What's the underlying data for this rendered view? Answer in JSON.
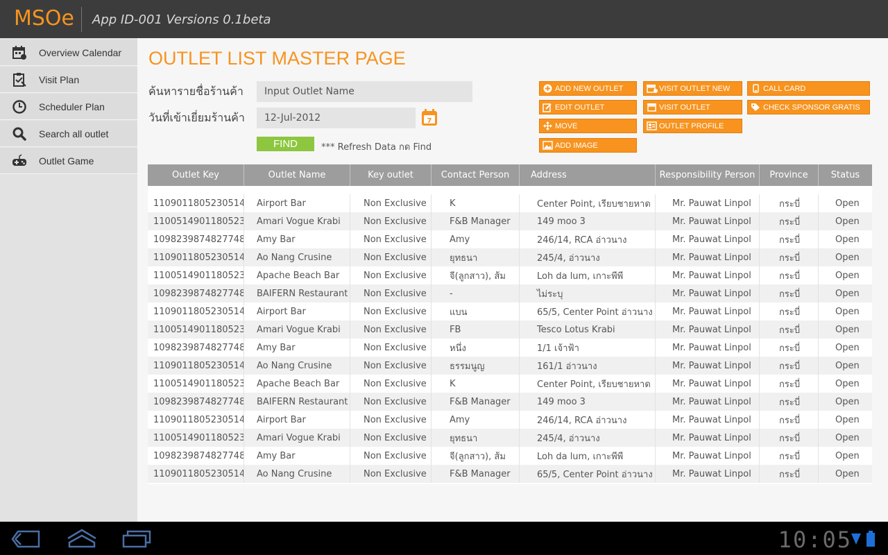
{
  "app": {
    "brand": "MSOe",
    "title": "App ID-001 Versions 0.1beta"
  },
  "sidebar": {
    "items": [
      {
        "label": "Overview Calendar",
        "icon": "calendar-icon"
      },
      {
        "label": "Visit Plan",
        "icon": "clipboard-icon"
      },
      {
        "label": "Scheduler Plan",
        "icon": "clock-icon"
      },
      {
        "label": "Search all outlet",
        "icon": "search-icon"
      },
      {
        "label": "Outlet Game",
        "icon": "gamepad-icon"
      }
    ]
  },
  "main": {
    "page_title": "OUTLET LIST MASTER PAGE",
    "search_label": "ค้นหารายชื่อร้านค้า",
    "search_placeholder": "Input Outlet Name",
    "date_label": "วันที่เข้าเยี่ยมร้านค้า",
    "date_value": "12-Jul-2012",
    "date_icon": "calendar-icon",
    "find_label": "FIND",
    "refresh_note": "*** Refresh Data กด Find"
  },
  "actions": {
    "add_new_outlet": "ADD NEW OUTLET",
    "edit_outlet": "EDIT OUTLET",
    "move": "MOVE",
    "add_image": "ADD IMAGE",
    "visit_outlet_new": "VISIT OUTLET NEW",
    "visit_outlet": "VISIT OUTLET",
    "outlet_profile": "OUTLET PROFILE",
    "call_card": "CALL CARD",
    "check_sponsor_gratis": "CHECK SPONSOR GRATIS"
  },
  "table": {
    "headers": [
      "Outlet Key",
      "Outlet Name",
      "Key outlet",
      "Contact Person",
      "Address",
      "Responsibility Person",
      "Province",
      "Status"
    ],
    "rows": [
      [
        "1109011805230514",
        "Airport Bar",
        "Non Exclusive",
        "K",
        "Center Point, เรียบชายหาด",
        "Mr. Pauwat Linpol",
        "กระบี่",
        "Open"
      ],
      [
        "1100514901180523",
        "Amari Vogue Krabi",
        "Non Exclusive",
        "F&B Manager",
        "149 moo 3",
        "Mr. Pauwat Linpol",
        "กระบี่",
        "Open"
      ],
      [
        "1098239874827748",
        "Amy Bar",
        "Non Exclusive",
        "Amy",
        "246/14, RCA อ่าวนาง",
        "Mr. Pauwat Linpol",
        "กระบี่",
        "Open"
      ],
      [
        "1109011805230514",
        "Ao Nang Crusine",
        "Non Exclusive",
        "ยุทธนา",
        "245/4, อ่าวนาง",
        "Mr. Pauwat Linpol",
        "กระบี่",
        "Open"
      ],
      [
        "1100514901180523",
        "Apache Beach Bar",
        "Non Exclusive",
        "จี(ลูกสาว), ส้ม",
        "Loh da lum, เกาะพีพี",
        "Mr. Pauwat Linpol",
        "กระบี่",
        "Open"
      ],
      [
        "1098239874827748",
        "BAIFERN Restaurant",
        "Non Exclusive",
        "-",
        "ไม่ระบุ",
        "Mr. Pauwat Linpol",
        "กระบี่",
        "Open"
      ],
      [
        "1109011805230514",
        "Airport Bar",
        "Non Exclusive",
        "แบน",
        "65/5, Center Point อ่าวนาง",
        "Mr. Pauwat Linpol",
        "กระบี่",
        "Open"
      ],
      [
        "1100514901180523",
        "Amari Vogue Krabi",
        "Non Exclusive",
        "FB",
        "Tesco Lotus Krabi",
        "Mr. Pauwat Linpol",
        "กระบี่",
        "Open"
      ],
      [
        "1098239874827748",
        "Amy Bar",
        "Non Exclusive",
        "หนึ่ง",
        "1/1 เจ้าฟ้า",
        "Mr. Pauwat Linpol",
        "กระบี่",
        "Open"
      ],
      [
        "1109011805230514",
        "Ao Nang Crusine",
        "Non Exclusive",
        "ธรรมนูญ",
        "161/1 อ่าวนาง",
        "Mr. Pauwat Linpol",
        "กระบี่",
        "Open"
      ],
      [
        "1100514901180523",
        "Apache Beach Bar",
        "Non Exclusive",
        "K",
        "Center Point, เรียบชายหาด",
        "Mr. Pauwat Linpol",
        "กระบี่",
        "Open"
      ],
      [
        "1098239874827748",
        "BAIFERN Restaurant",
        "Non Exclusive",
        "F&B Manager",
        "149 moo 3",
        "Mr. Pauwat Linpol",
        "กระบี่",
        "Open"
      ],
      [
        "1109011805230514",
        "Airport Bar",
        "Non Exclusive",
        "Amy",
        "246/14, RCA อ่าวนาง",
        "Mr. Pauwat Linpol",
        "กระบี่",
        "Open"
      ],
      [
        "1100514901180523",
        "Amari Vogue Krabi",
        "Non Exclusive",
        "ยุทธนา",
        "245/4, อ่าวนาง",
        "Mr. Pauwat Linpol",
        "กระบี่",
        "Open"
      ],
      [
        "1098239874827748",
        "Amy Bar",
        "Non Exclusive",
        "จี(ลูกสาว), ส้ม",
        "Loh da lum, เกาะพีพี",
        "Mr. Pauwat Linpol",
        "กระบี่",
        "Open"
      ],
      [
        "1109011805230514",
        "Ao Nang Crusine",
        "Non Exclusive",
        "F&B Manager",
        "65/5, Center Point อ่าวนาง",
        "Mr. Pauwat Linpol",
        "กระบี่",
        "Open"
      ]
    ]
  },
  "system_bar": {
    "clock": "10:05",
    "icons": [
      "back-icon",
      "home-icon",
      "recent-apps-icon",
      "wifi-icon",
      "battery-icon"
    ]
  },
  "colors": {
    "accent": "#f7931e",
    "find_button": "#8dc63f",
    "topbar": "#3c3c3c",
    "table_header": "#9d9d9d"
  }
}
